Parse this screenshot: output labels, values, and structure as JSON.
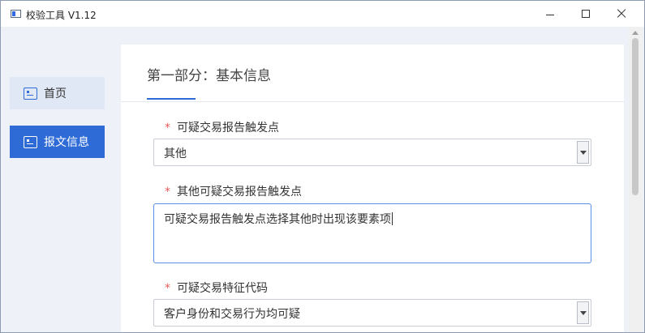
{
  "window": {
    "title": "校验工具 V1.12"
  },
  "nav": {
    "items": [
      {
        "label": "首页",
        "icon": "document-icon",
        "active": false
      },
      {
        "label": "报文信息",
        "icon": "document-icon",
        "active": true
      }
    ]
  },
  "section": {
    "title": "第一部分：基本信息"
  },
  "form": {
    "required_mark": "*",
    "fields": [
      {
        "label": "可疑交易报告触发点",
        "type": "select",
        "value": "其他"
      },
      {
        "label": "其他可疑交易报告触发点",
        "type": "textarea",
        "value": "可疑交易报告触发点选择其他时出现该要素项"
      },
      {
        "label": "可疑交易特征代码",
        "type": "select",
        "value": "客户身份和交易行为均可疑"
      }
    ]
  },
  "colors": {
    "accent": "#2e6bd6",
    "required": "#e85a5a",
    "background": "#eef1f8"
  }
}
